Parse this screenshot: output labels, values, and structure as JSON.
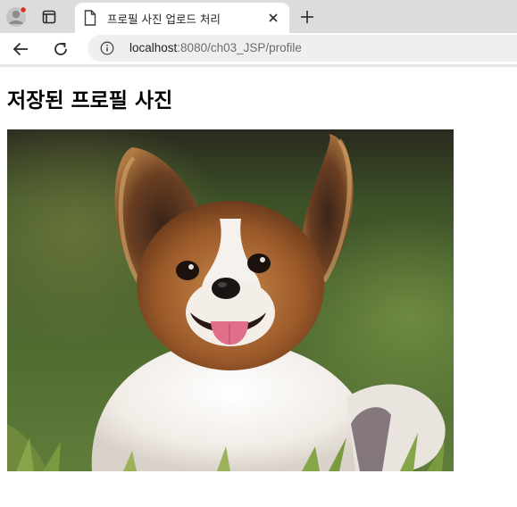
{
  "browser": {
    "tab": {
      "title": "프로필 사진 업로드 처리"
    },
    "address_bar": {
      "host": "localhost",
      "rest": ":8080/ch03_JSP/profile"
    }
  },
  "page": {
    "title": "저장된 프로필 사진",
    "image": {
      "alt": "papillon dog profile photo",
      "subject": "papillon-dog"
    }
  },
  "icons": {
    "profile": "avatar-icon",
    "tabs": "tab-actions-icon",
    "document": "document-icon",
    "close": "close-icon",
    "new_tab": "plus-icon",
    "back": "back-arrow-icon",
    "reload": "reload-icon",
    "info": "info-icon"
  },
  "colors": {
    "tabbar_bg": "#dcdcdc",
    "omnibox_bg": "#efefef",
    "notification_dot": "#d93025"
  }
}
